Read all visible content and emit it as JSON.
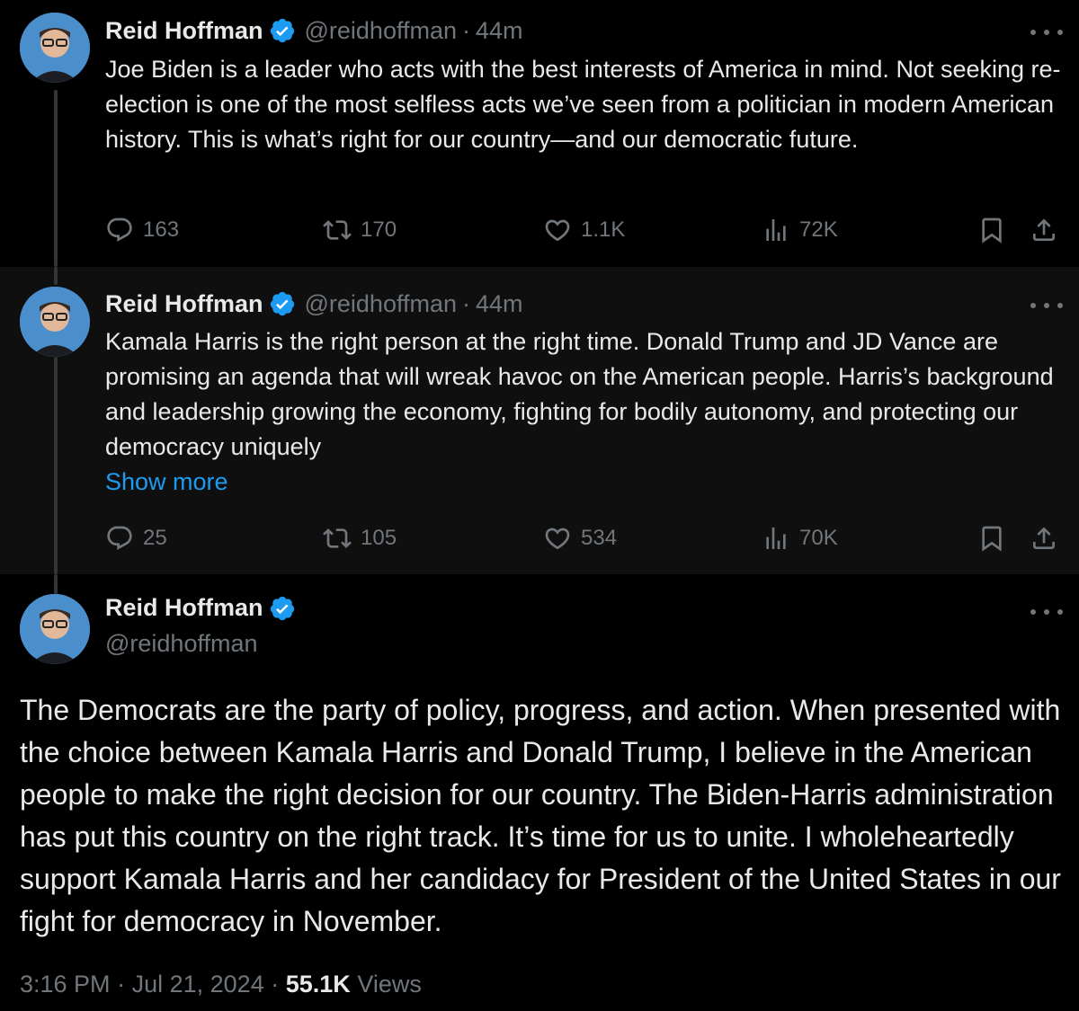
{
  "colors": {
    "background": "#000000",
    "text": "#e7e9ea",
    "muted": "#71767b",
    "link": "#1d9bf0",
    "verified": "#1d9bf0"
  },
  "tweets": [
    {
      "name": "Reid Hoffman",
      "handle": "@reidhoffman",
      "separator": "·",
      "time": "44m",
      "text": "Joe Biden is a leader who acts with the best interests of America in mind. Not seeking re-election is one of the most selfless acts we’ve seen from a politician in modern American history. This is what’s right for our country—and our democratic future.",
      "replies": "163",
      "reposts": "170",
      "likes": "1.1K",
      "views": "72K"
    },
    {
      "name": "Reid Hoffman",
      "handle": "@reidhoffman",
      "separator": "·",
      "time": "44m",
      "text": "Kamala Harris is the right person at the right time. Donald Trump and JD Vance are promising an agenda that will wreak havoc on the American people. Harris’s background and leadership growing the economy, fighting for bodily autonomy, and protecting our democracy uniquely",
      "show_more": "Show more",
      "replies": "25",
      "reposts": "105",
      "likes": "534",
      "views": "70K"
    }
  ],
  "main_tweet": {
    "name": "Reid Hoffman",
    "handle": "@reidhoffman",
    "text": "The Democrats are the party of policy, progress, and action. When presented with the choice between Kamala Harris and Donald Trump, I believe in the American people to make the right decision for our country. The Biden-Harris administration has put this country on the right track. It’s time for us to unite. I wholeheartedly support Kamala Harris and her candidacy for President of the United States in our fight for democracy in November.",
    "time": "3:16 PM",
    "date": "Jul 21, 2024",
    "separator": "·",
    "views_count": "55.1K",
    "views_label": "Views"
  },
  "icons": [
    "reply-icon",
    "repost-icon",
    "like-icon",
    "views-icon",
    "bookmark-icon",
    "share-icon",
    "verified-badge-icon",
    "more-icon"
  ]
}
